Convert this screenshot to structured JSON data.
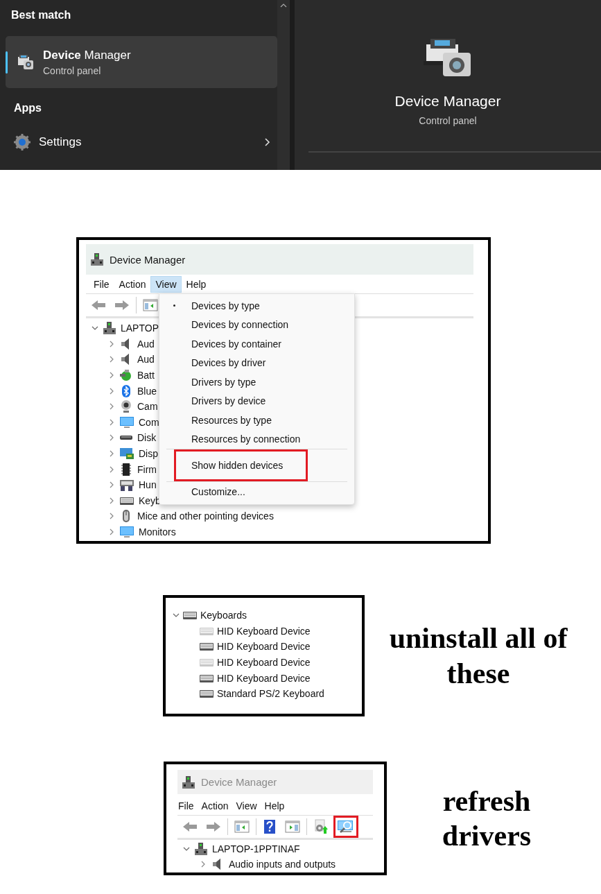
{
  "search": {
    "best_match_heading": "Best match",
    "best_match": {
      "title": "**Device** Manager",
      "subtitle": "Control panel",
      "selected": true
    },
    "apps_heading": "Apps",
    "apps": [
      {
        "label": "Settings"
      }
    ]
  },
  "preview": {
    "title": "Device Manager",
    "subtitle": "Control panel"
  },
  "step_1": {
    "window": {
      "title": "Device Manager",
      "active": true
    },
    "menu": [
      {
        "label": "File",
        "selected": false
      },
      {
        "label": "Action",
        "selected": false
      },
      {
        "label": "View",
        "selected": true
      },
      {
        "label": "Help",
        "selected": false
      }
    ],
    "toolbar": [
      {
        "highlighted": false
      },
      {
        "highlighted": false
      },
      {
        "highlighted": false
      }
    ],
    "tree": {
      "label": "LAPTOP",
      "expanded": true,
      "children": [
        {
          "label": "Aud",
          "expanded": false
        },
        {
          "label": "Aud",
          "expanded": false
        },
        {
          "label": "Batt",
          "expanded": false
        },
        {
          "label": "Blue",
          "expanded": false
        },
        {
          "label": "Cam",
          "expanded": false
        },
        {
          "label": "Com",
          "expanded": false
        },
        {
          "label": "Disk",
          "expanded": false
        },
        {
          "label": "Disp",
          "expanded": false
        },
        {
          "label": "Firm",
          "expanded": false
        },
        {
          "label": "Hun",
          "expanded": false
        },
        {
          "label": "Keyb",
          "expanded": false
        },
        {
          "label": "Mice and other pointing devices",
          "expanded": false
        },
        {
          "label": "Monitors",
          "expanded": false
        }
      ]
    },
    "view_menu": [
      {
        "kind": "item",
        "label": "Devices by type",
        "checked": true,
        "highlighted": false
      },
      {
        "kind": "item",
        "label": "Devices by connection",
        "checked": false,
        "highlighted": false
      },
      {
        "kind": "item",
        "label": "Devices by container",
        "checked": false,
        "highlighted": false
      },
      {
        "kind": "item",
        "label": "Devices by driver",
        "checked": false,
        "highlighted": false
      },
      {
        "kind": "item",
        "label": "Drivers by type",
        "checked": false,
        "highlighted": false
      },
      {
        "kind": "item",
        "label": "Drivers by device",
        "checked": false,
        "highlighted": false
      },
      {
        "kind": "item",
        "label": "Resources by type",
        "checked": false,
        "highlighted": false
      },
      {
        "kind": "item",
        "label": "Resources by connection",
        "checked": false,
        "highlighted": false
      },
      {
        "kind": "separator"
      },
      {
        "kind": "item",
        "label": "Show hidden devices",
        "checked": false,
        "highlighted": true
      },
      {
        "kind": "separator"
      },
      {
        "kind": "item",
        "label": "Customize...",
        "checked": false,
        "highlighted": false
      }
    ]
  },
  "step_2": {
    "tree": {
      "label": "Keyboards",
      "expanded": true,
      "children": [
        {
          "label": "HID Keyboard Device",
          "hidden": true
        },
        {
          "label": "HID Keyboard Device",
          "hidden": false
        },
        {
          "label": "HID Keyboard Device",
          "hidden": true
        },
        {
          "label": "HID Keyboard Device",
          "hidden": false
        },
        {
          "label": "Standard PS/2 Keyboard",
          "hidden": false
        }
      ]
    },
    "note": "uninstall all of these"
  },
  "step_3": {
    "window": {
      "title": "Device Manager",
      "active": false
    },
    "menu": [
      {
        "label": "File",
        "selected": false
      },
      {
        "label": "Action",
        "selected": false
      },
      {
        "label": "View",
        "selected": false
      },
      {
        "label": "Help",
        "selected": false
      }
    ],
    "toolbar": [
      {
        "highlighted": false
      },
      {
        "highlighted": false
      },
      {
        "highlighted": false
      },
      {
        "highlighted": false
      },
      {
        "highlighted": false
      },
      {
        "highlighted": false
      },
      {
        "highlighted": true
      }
    ],
    "tree": {
      "label": "LAPTOP-1PPTINAF",
      "expanded": true,
      "children": [
        {
          "label": "Audio inputs and outputs",
          "expanded": false
        }
      ]
    },
    "note": "refresh drivers"
  }
}
